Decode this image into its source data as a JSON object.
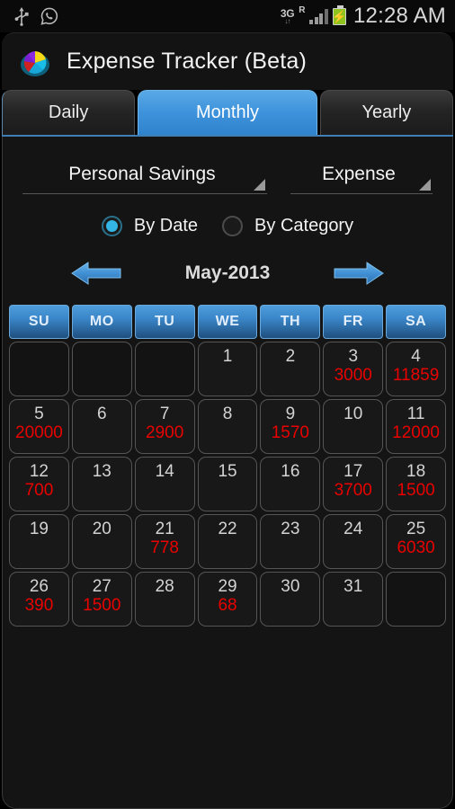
{
  "statusbar": {
    "icons": [
      "usb-icon",
      "whatsapp-icon"
    ],
    "network_label": "3G",
    "network_arrows": "↓↑",
    "roaming": "R",
    "battery_state": "charging",
    "time": "12:28 AM"
  },
  "titlebar": {
    "app_name": "Expense Tracker (Beta)",
    "icon": "pie-chart-app-icon"
  },
  "tabs": [
    {
      "label": "Daily",
      "active": false
    },
    {
      "label": "Monthly",
      "active": true
    },
    {
      "label": "Yearly",
      "active": false
    }
  ],
  "filters": {
    "account_spinner": {
      "value": "Personal Savings",
      "caret": "dropdown-caret-icon"
    },
    "type_spinner": {
      "value": "Expense",
      "caret": "dropdown-caret-icon"
    },
    "group_by": {
      "options": [
        {
          "label": "By Date",
          "selected": true
        },
        {
          "label": "By Category",
          "selected": false
        }
      ]
    }
  },
  "month_nav": {
    "prev_icon": "arrow-left-icon",
    "next_icon": "arrow-right-icon",
    "current_month": "May-2013"
  },
  "calendar": {
    "weekdays": [
      "SU",
      "MO",
      "TU",
      "WE",
      "TH",
      "FR",
      "SA"
    ],
    "weeks": [
      [
        {
          "day": "",
          "amount": ""
        },
        {
          "day": "",
          "amount": ""
        },
        {
          "day": "",
          "amount": ""
        },
        {
          "day": "1",
          "amount": ""
        },
        {
          "day": "2",
          "amount": ""
        },
        {
          "day": "3",
          "amount": "3000"
        },
        {
          "day": "4",
          "amount": "11859"
        }
      ],
      [
        {
          "day": "5",
          "amount": "20000"
        },
        {
          "day": "6",
          "amount": ""
        },
        {
          "day": "7",
          "amount": "2900"
        },
        {
          "day": "8",
          "amount": ""
        },
        {
          "day": "9",
          "amount": "1570"
        },
        {
          "day": "10",
          "amount": ""
        },
        {
          "day": "11",
          "amount": "12000"
        }
      ],
      [
        {
          "day": "12",
          "amount": "700"
        },
        {
          "day": "13",
          "amount": ""
        },
        {
          "day": "14",
          "amount": ""
        },
        {
          "day": "15",
          "amount": ""
        },
        {
          "day": "16",
          "amount": ""
        },
        {
          "day": "17",
          "amount": "3700"
        },
        {
          "day": "18",
          "amount": "1500"
        }
      ],
      [
        {
          "day": "19",
          "amount": ""
        },
        {
          "day": "20",
          "amount": ""
        },
        {
          "day": "21",
          "amount": "778"
        },
        {
          "day": "22",
          "amount": ""
        },
        {
          "day": "23",
          "amount": ""
        },
        {
          "day": "24",
          "amount": ""
        },
        {
          "day": "25",
          "amount": "6030"
        }
      ],
      [
        {
          "day": "26",
          "amount": "390"
        },
        {
          "day": "27",
          "amount": "1500"
        },
        {
          "day": "28",
          "amount": ""
        },
        {
          "day": "29",
          "amount": "68"
        },
        {
          "day": "30",
          "amount": ""
        },
        {
          "day": "31",
          "amount": ""
        },
        {
          "day": "",
          "amount": ""
        }
      ]
    ]
  },
  "colors": {
    "accent_blue": "#3f93dc",
    "amount_red": "#e90000",
    "radio_cyan": "#33b5e5",
    "background": "#141414"
  }
}
